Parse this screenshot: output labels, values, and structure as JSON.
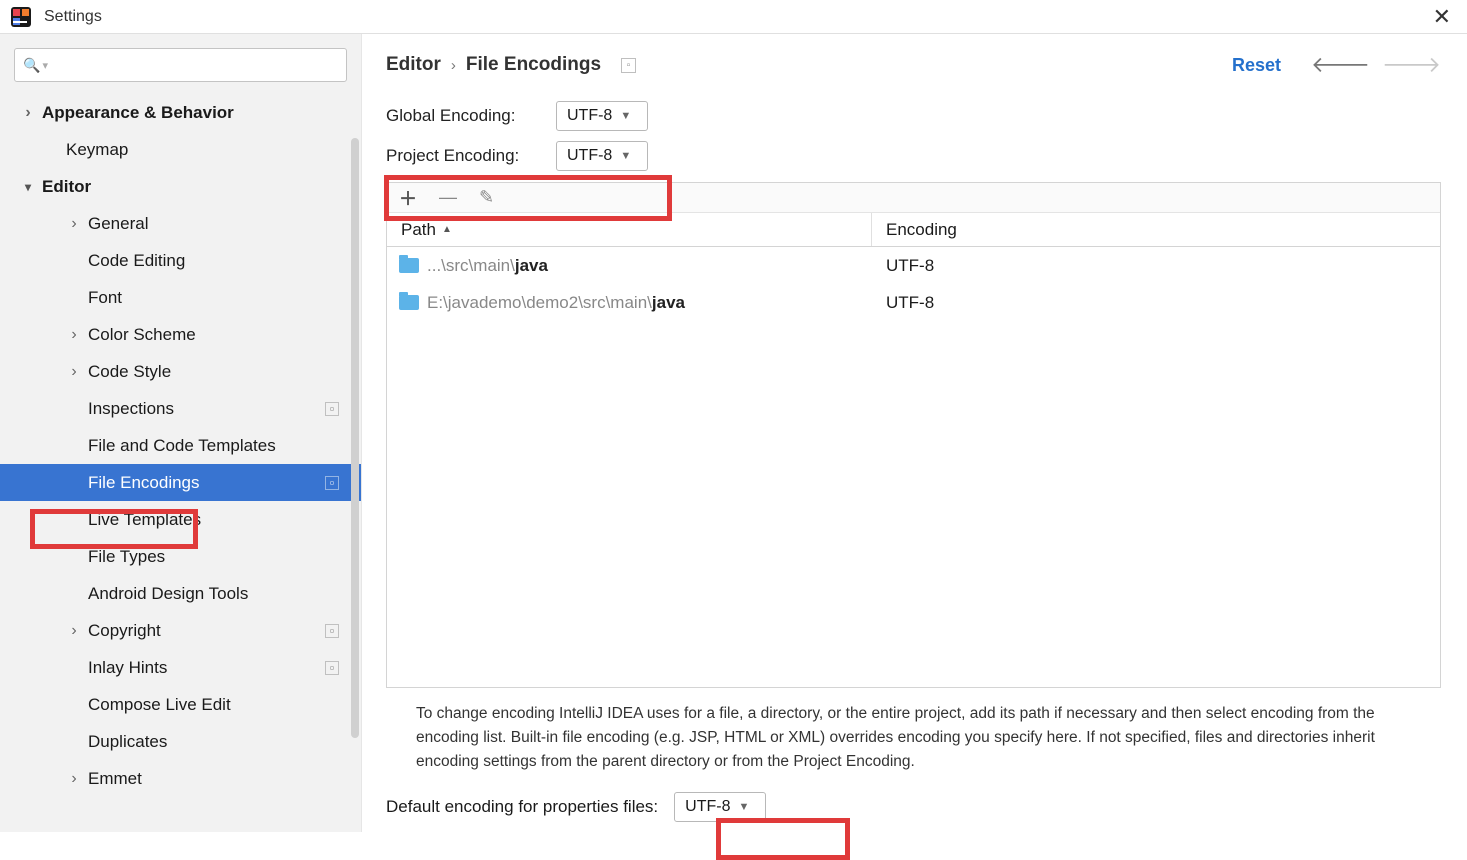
{
  "window": {
    "title": "Settings"
  },
  "sidebar": {
    "search_placeholder": "",
    "items": [
      {
        "label": "Appearance & Behavior",
        "arrow": "right",
        "bold": true,
        "lvl": 0
      },
      {
        "label": "Keymap",
        "arrow": "none",
        "bold": true,
        "lvl": 0,
        "indent": 1
      },
      {
        "label": "Editor",
        "arrow": "down",
        "bold": true,
        "lvl": 0
      },
      {
        "label": "General",
        "arrow": "right",
        "lvl": 2
      },
      {
        "label": "Code Editing",
        "arrow": "none",
        "lvl": 2
      },
      {
        "label": "Font",
        "arrow": "none",
        "lvl": 2
      },
      {
        "label": "Color Scheme",
        "arrow": "right",
        "lvl": 2
      },
      {
        "label": "Code Style",
        "arrow": "right",
        "lvl": 2
      },
      {
        "label": "Inspections",
        "arrow": "none",
        "lvl": 2,
        "badge": true
      },
      {
        "label": "File and Code Templates",
        "arrow": "none",
        "lvl": 2
      },
      {
        "label": "File Encodings",
        "arrow": "none",
        "lvl": 2,
        "selected": true,
        "badge": true
      },
      {
        "label": "Live Templates",
        "arrow": "none",
        "lvl": 2
      },
      {
        "label": "File Types",
        "arrow": "none",
        "lvl": 2
      },
      {
        "label": "Android Design Tools",
        "arrow": "none",
        "lvl": 2
      },
      {
        "label": "Copyright",
        "arrow": "right",
        "lvl": 2,
        "badge": true
      },
      {
        "label": "Inlay Hints",
        "arrow": "none",
        "lvl": 2,
        "badge": true
      },
      {
        "label": "Compose Live Edit",
        "arrow": "none",
        "lvl": 2
      },
      {
        "label": "Duplicates",
        "arrow": "none",
        "lvl": 2
      },
      {
        "label": "Emmet",
        "arrow": "right",
        "lvl": 2
      }
    ]
  },
  "breadcrumb": {
    "seg1": "Editor",
    "seg2": "File Encodings"
  },
  "actions": {
    "reset": "Reset"
  },
  "form": {
    "global_label": "Global Encoding:",
    "global_value": "UTF-8",
    "project_label": "Project Encoding:",
    "project_value": "UTF-8"
  },
  "table": {
    "head_path": "Path",
    "head_enc": "Encoding",
    "rows": [
      {
        "grey": "...\\src\\main\\",
        "bold": "java",
        "enc": "UTF-8"
      },
      {
        "grey": "E:\\javademo\\demo2\\src\\main\\",
        "bold": "java",
        "enc": "UTF-8"
      }
    ]
  },
  "help_text": "To change encoding IntelliJ IDEA uses for a file, a directory, or the entire project, add its path if necessary and then select encoding from the encoding list. Built-in file encoding (e.g. JSP, HTML or XML) overrides encoding you specify here. If not specified, files and directories inherit encoding settings from the parent directory or from the Project Encoding.",
  "props": {
    "label": "Default encoding for properties files:",
    "value": "UTF-8"
  }
}
